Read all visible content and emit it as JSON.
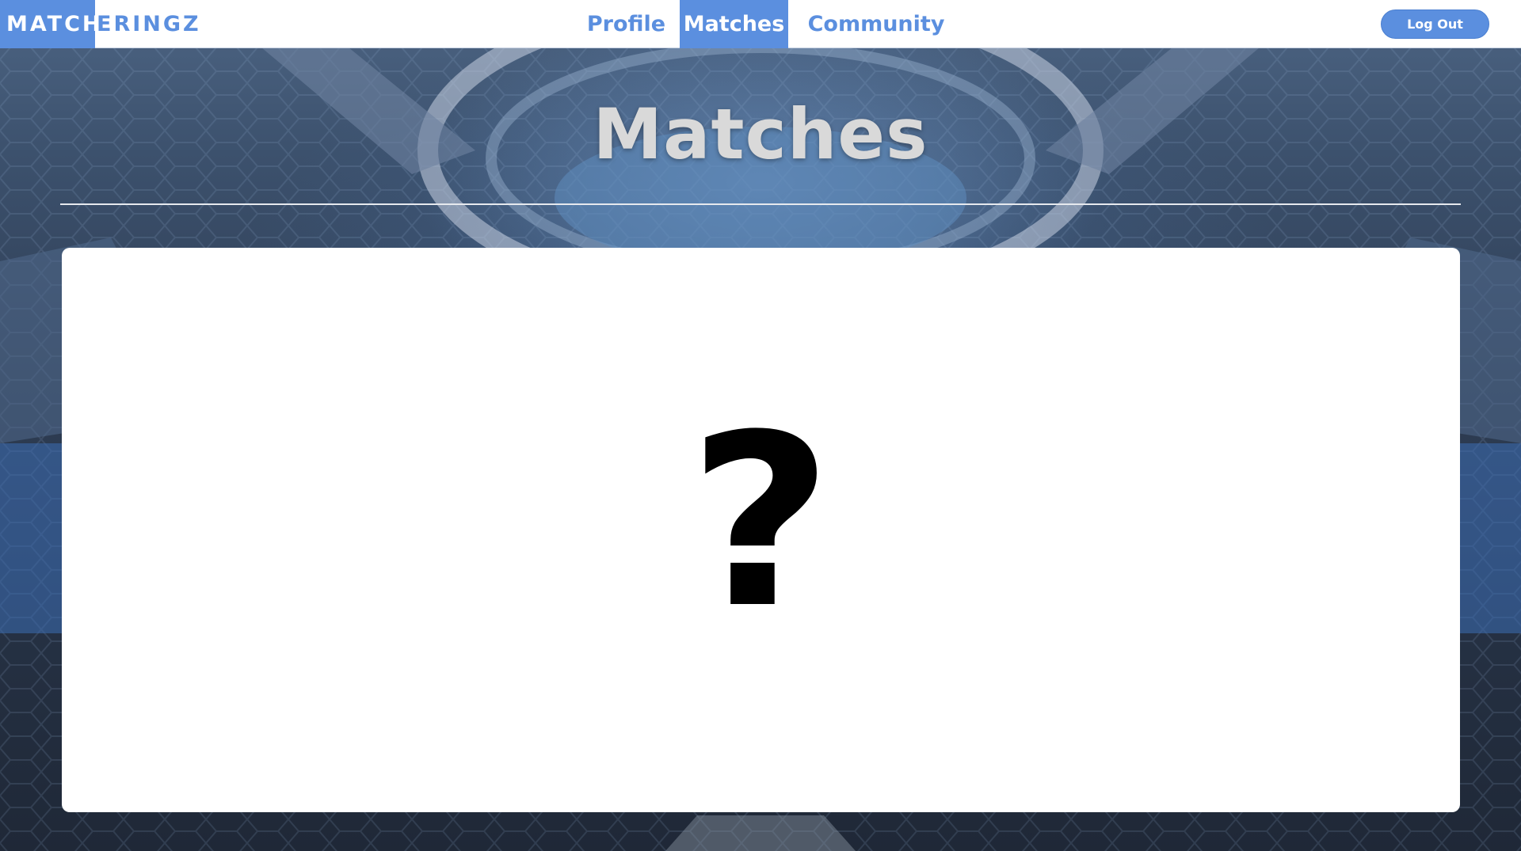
{
  "brand": {
    "highlight": "MATCH",
    "rest": "ERINGZ",
    "accent_color": "#5b8fdf"
  },
  "nav": {
    "links": [
      {
        "label": "Profile",
        "active": false
      },
      {
        "label": "Matches",
        "active": true
      },
      {
        "label": "Community",
        "active": false
      }
    ],
    "logout_label": "Log Out"
  },
  "page": {
    "title": "Matches"
  },
  "card": {
    "placeholder_symbol": "?"
  },
  "colors": {
    "nav_bg": "#ffffff",
    "accent": "#5b8fdf",
    "title": "#d9d9d9",
    "card_bg": "#ffffff"
  }
}
